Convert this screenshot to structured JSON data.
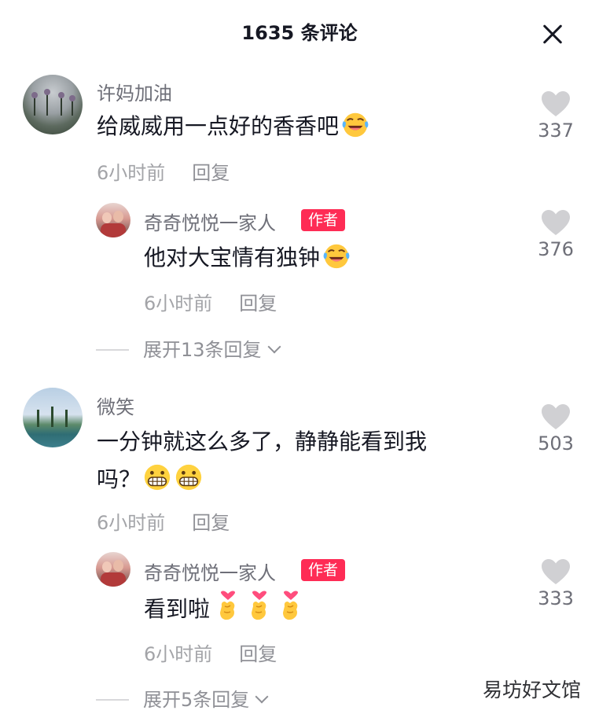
{
  "header": {
    "title": "1635 条评论"
  },
  "comments": [
    {
      "username": "许妈加油",
      "text": "给威威用一点好的香香吧",
      "emoji": "laughing-crying-emoji",
      "time": "6小时前",
      "reply_label": "回复",
      "likes": "337",
      "reply": {
        "username": "奇奇悦悦一家人",
        "author_tag": "作者",
        "text": "他对大宝情有独钟",
        "emoji": "laughing-crying-emoji",
        "time": "6小时前",
        "reply_label": "回复",
        "likes": "376"
      },
      "expand_label": "展开13条回复"
    },
    {
      "username": "微笑",
      "text_line1": "一分钟就这么多了，静静能看到我",
      "text_line2": "吗？",
      "emoji": "grinning-emoji",
      "time": "6小时前",
      "reply_label": "回复",
      "likes": "503",
      "reply": {
        "username": "奇奇悦悦一家人",
        "author_tag": "作者",
        "text": "看到啦",
        "emoji": "finger-heart-emoji",
        "time": "6小时前",
        "reply_label": "回复",
        "likes": "333"
      },
      "expand_label": "展开5条回复"
    }
  ],
  "watermark": "易坊好文馆",
  "colors": {
    "author_tag": "#fe2c55",
    "like_icon": "#d0d0d3",
    "secondary_text": "#a3a4a8"
  }
}
